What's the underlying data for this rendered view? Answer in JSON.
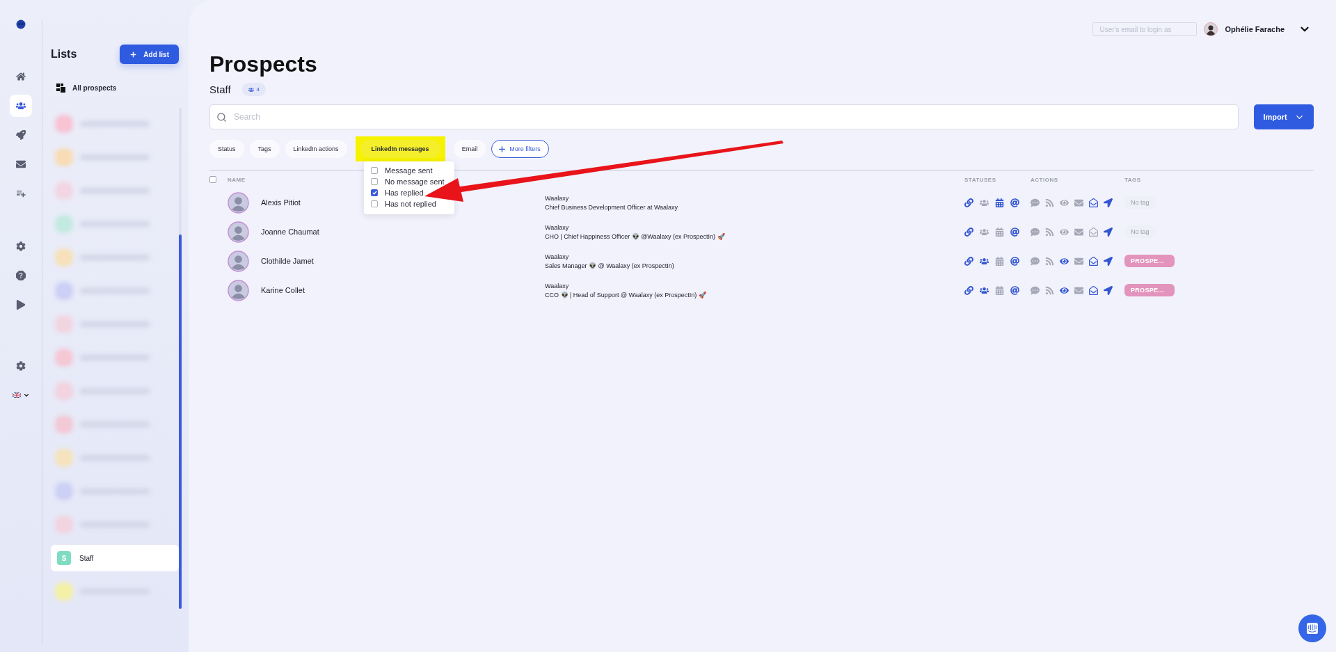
{
  "nav": {
    "groups": [
      [
        {
          "kind": "logo",
          "selected": false
        }
      ],
      [
        {
          "kind": "home",
          "selected": false
        },
        {
          "kind": "people",
          "selected": true
        },
        {
          "kind": "rocket",
          "selected": false
        },
        {
          "kind": "mail",
          "selected": false
        },
        {
          "kind": "list",
          "selected": false
        }
      ],
      [
        {
          "kind": "settings",
          "selected": false
        },
        {
          "kind": "help",
          "selected": false
        },
        {
          "kind": "play",
          "selected": false
        }
      ],
      [
        {
          "kind": "settings",
          "selected": false
        },
        {
          "kind": "language",
          "selected": false
        }
      ]
    ]
  },
  "lists_panel": {
    "title": "Lists",
    "add_button": "Add list",
    "all_prospects": "All prospects",
    "items": [
      {
        "kind": "blurred",
        "color": "#f7c3d5",
        "selected": false
      },
      {
        "kind": "blurred",
        "color": "#f8dcb6",
        "selected": false
      },
      {
        "kind": "blurred",
        "color": "#f3d6e3",
        "selected": false
      },
      {
        "kind": "blurred",
        "color": "#c3eadf",
        "selected": false
      },
      {
        "kind": "blurred",
        "color": "#f6e1bb",
        "selected": false
      },
      {
        "kind": "blurred",
        "color": "#cdd0f6",
        "selected": false
      },
      {
        "kind": "blurred",
        "color": "#f1d6e2",
        "selected": false
      },
      {
        "kind": "blurred",
        "color": "#f4c8d5",
        "selected": false
      },
      {
        "kind": "blurred",
        "color": "#f2d3e0",
        "selected": false
      },
      {
        "kind": "blurred",
        "color": "#f3c9d6",
        "selected": false
      },
      {
        "kind": "blurred",
        "color": "#f5e3bd",
        "selected": false
      },
      {
        "kind": "blurred",
        "color": "#cdd1f6",
        "selected": false
      },
      {
        "kind": "blurred",
        "color": "#f1d4e0",
        "selected": false
      },
      {
        "kind": "list",
        "initial": "S",
        "name": "Staff",
        "color": "#7fdcc0",
        "selected": true
      },
      {
        "kind": "blurred",
        "color": "#f3f0a8",
        "selected": false
      }
    ]
  },
  "header": {
    "login_placeholder": "User's email to login as",
    "user_name": "Ophélie Farache"
  },
  "page": {
    "title": "Prospects",
    "list_name": "Staff",
    "count": "4"
  },
  "search": {
    "placeholder": "Search"
  },
  "import_button": "Import",
  "filters": [
    {
      "label": "Status",
      "highlighted": false
    },
    {
      "label": "Tags",
      "highlighted": false
    },
    {
      "label": "LinkedIn actions",
      "highlighted": false
    },
    {
      "label": "LinkedIn messages",
      "highlighted": true
    },
    {
      "label": "Email",
      "highlighted": false
    }
  ],
  "more_filters": "More filters",
  "dropdown": {
    "options": [
      {
        "label": "Message sent",
        "checked": false
      },
      {
        "label": "No message sent",
        "checked": false
      },
      {
        "label": "Has replied",
        "checked": true
      },
      {
        "label": "Has not replied",
        "checked": false
      }
    ]
  },
  "table": {
    "select_all": {
      "checked": false
    },
    "columns": {
      "name": "NAME",
      "statuses": "STATUSES",
      "actions": "ACTIONS",
      "tags": "TAGS"
    },
    "rows": [
      {
        "name": "Alexis Pitiot",
        "company": "Waalaxy",
        "headline": "Chief Business Development Officer at Waalaxy",
        "statuses": [
          {
            "kind": "link",
            "on": true
          },
          {
            "kind": "people",
            "on": false
          },
          {
            "kind": "calendar",
            "on": true
          },
          {
            "kind": "at",
            "on": true
          }
        ],
        "actions": [
          {
            "kind": "comment",
            "on": false
          },
          {
            "kind": "rss",
            "on": false
          },
          {
            "kind": "eye",
            "on": false
          },
          {
            "kind": "mail",
            "on": false
          },
          {
            "kind": "open-mail",
            "on": true
          },
          {
            "kind": "send",
            "on": true
          }
        ],
        "tag": {
          "kind": "none",
          "label": "No tag"
        }
      },
      {
        "name": "Joanne Chaumat",
        "company": "Waalaxy",
        "headline": "CHO | Chief Happiness Officer 👽 @Waalaxy (ex ProspectIn) 🚀",
        "statuses": [
          {
            "kind": "link",
            "on": true
          },
          {
            "kind": "people",
            "on": false
          },
          {
            "kind": "calendar",
            "on": false
          },
          {
            "kind": "at",
            "on": true
          }
        ],
        "actions": [
          {
            "kind": "comment",
            "on": false
          },
          {
            "kind": "rss",
            "on": false
          },
          {
            "kind": "eye",
            "on": false
          },
          {
            "kind": "mail",
            "on": false
          },
          {
            "kind": "open-mail",
            "on": false
          },
          {
            "kind": "send",
            "on": true
          }
        ],
        "tag": {
          "kind": "none",
          "label": "No tag"
        }
      },
      {
        "name": "Clothilde Jamet",
        "company": "Waalaxy",
        "headline": "Sales Manager 👽 @ Waalaxy (ex ProspectIn)",
        "statuses": [
          {
            "kind": "link",
            "on": true
          },
          {
            "kind": "people",
            "on": true
          },
          {
            "kind": "calendar",
            "on": false
          },
          {
            "kind": "at",
            "on": true
          }
        ],
        "actions": [
          {
            "kind": "comment",
            "on": false
          },
          {
            "kind": "rss",
            "on": false
          },
          {
            "kind": "eye",
            "on": true
          },
          {
            "kind": "mail",
            "on": false
          },
          {
            "kind": "open-mail",
            "on": true
          },
          {
            "kind": "send",
            "on": true
          }
        ],
        "tag": {
          "kind": "tag",
          "label": "PROSPE..."
        }
      },
      {
        "name": "Karine Collet",
        "company": "Waalaxy",
        "headline": "CCO 👽 | Head of Support @ Waalaxy (ex ProspectIn) 🚀",
        "statuses": [
          {
            "kind": "link",
            "on": true
          },
          {
            "kind": "people",
            "on": true
          },
          {
            "kind": "calendar",
            "on": false
          },
          {
            "kind": "at",
            "on": true
          }
        ],
        "actions": [
          {
            "kind": "comment",
            "on": false
          },
          {
            "kind": "rss",
            "on": false
          },
          {
            "kind": "eye",
            "on": true
          },
          {
            "kind": "mail",
            "on": false
          },
          {
            "kind": "open-mail",
            "on": true
          },
          {
            "kind": "send",
            "on": true
          }
        ],
        "tag": {
          "kind": "tag",
          "label": "PROSPE..."
        }
      }
    ]
  }
}
